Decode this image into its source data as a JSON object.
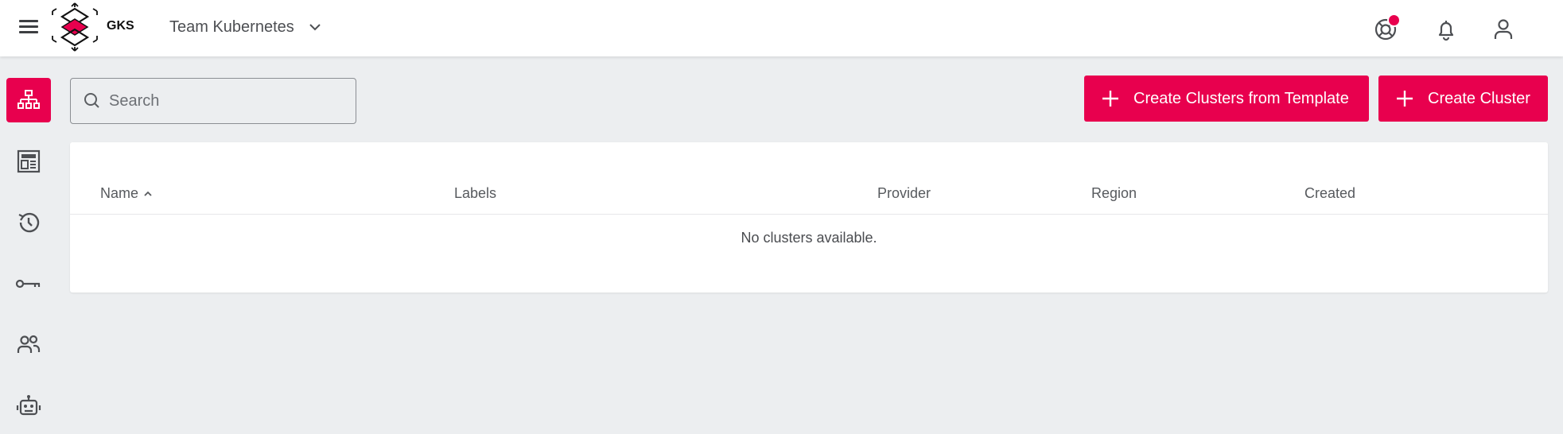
{
  "app": {
    "logo_text": "GKS",
    "brand_color": "#e8004e"
  },
  "header": {
    "team_name": "Team Kubernetes",
    "icons": [
      "menu-icon",
      "support-icon",
      "bell-icon",
      "user-icon"
    ]
  },
  "sidebar": {
    "items": [
      {
        "name": "clusters",
        "icon": "sitemap-icon",
        "active": true
      },
      {
        "name": "templates",
        "icon": "dashboard-icon",
        "active": false
      },
      {
        "name": "history",
        "icon": "history-icon",
        "active": false
      },
      {
        "name": "ssh-keys",
        "icon": "key-icon",
        "active": false
      },
      {
        "name": "members",
        "icon": "people-icon",
        "active": false
      },
      {
        "name": "service-accounts",
        "icon": "robot-icon",
        "active": false
      }
    ]
  },
  "toolbar": {
    "search_placeholder": "Search",
    "create_from_template_label": "Create Clusters from Template",
    "create_cluster_label": "Create Cluster"
  },
  "table": {
    "columns": [
      "Name",
      "Labels",
      "Provider",
      "Region",
      "Created"
    ],
    "sort_indicator": "^",
    "empty_message": "No clusters available."
  }
}
